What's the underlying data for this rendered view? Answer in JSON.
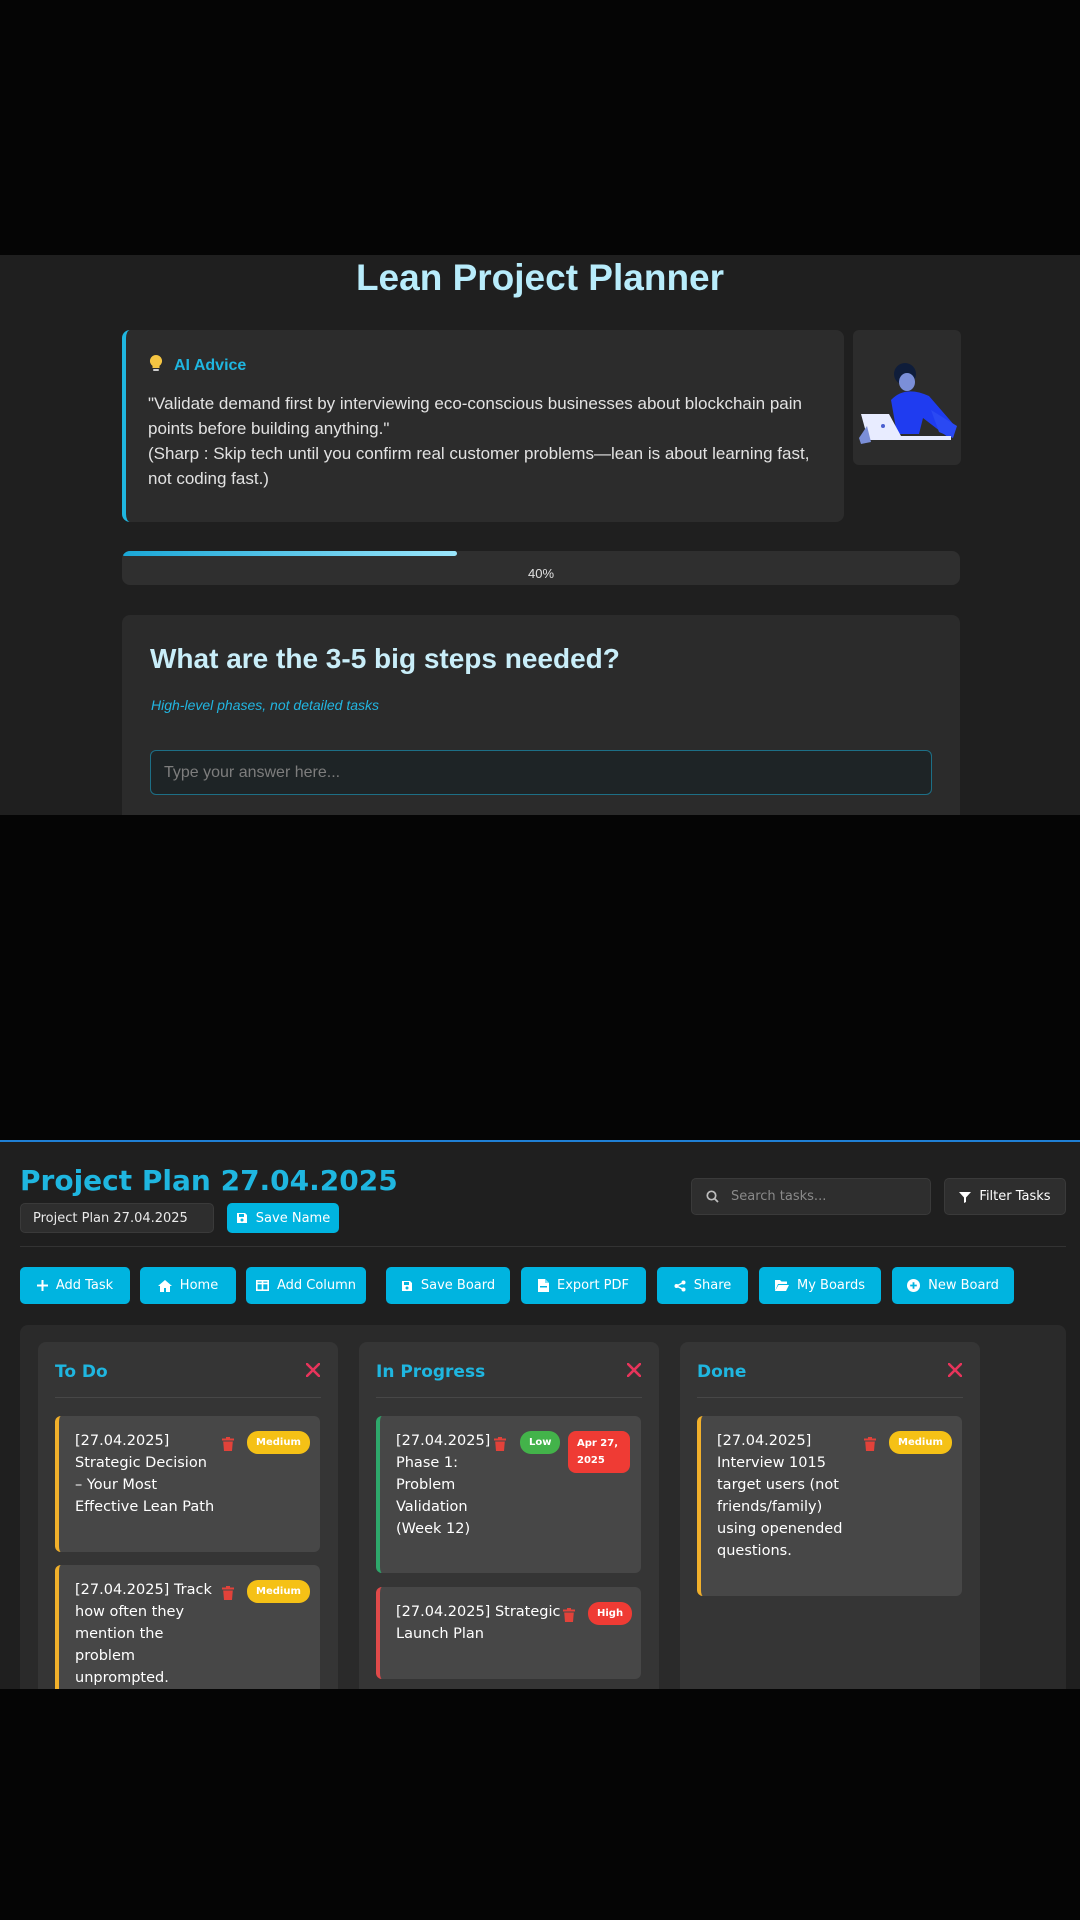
{
  "planner": {
    "title": "Lean Project Planner",
    "advice": {
      "label": "AI Advice",
      "quote": "\"Validate demand first by interviewing eco-conscious businesses about blockchain pain points before building anything.\"",
      "note": "(Sharp : Skip tech until you confirm real customer problems—lean is about learning fast, not coding fast.)"
    },
    "progress": {
      "value": 0.4,
      "label": "40%"
    },
    "question": {
      "title": "What are the 3-5 big steps needed?",
      "hint": "High-level phases, not detailed tasks",
      "placeholder": "Type your answer here...",
      "value": ""
    }
  },
  "board": {
    "title": "Project Plan 27.04.2025",
    "name_value": "Project Plan 27.04.2025",
    "save_name_label": "Save Name",
    "search_placeholder": "Search tasks...",
    "filter_label": "Filter Tasks",
    "toolbar": {
      "add_task": "Add Task",
      "home": "Home",
      "add_column": "Add Column",
      "save_board": "Save Board",
      "export_pdf": "Export PDF",
      "share": "Share",
      "my_boards": "My Boards",
      "new_board": "New Board"
    },
    "columns": [
      {
        "title": "To Do",
        "cards": [
          {
            "text": "[27.04.2025] Strategic Decision – Your Most Effective Lean Path",
            "priority": "Medium"
          },
          {
            "text": "[27.04.2025] Track how often they mention the problem unprompted.",
            "priority": "Medium"
          }
        ]
      },
      {
        "title": "In Progress",
        "cards": [
          {
            "text": "[27.04.2025] Phase 1: Problem Validation (Week 12)",
            "priority": "Low",
            "due": "Apr 27, 2025"
          },
          {
            "text": "[27.04.2025] Strategic Launch Plan",
            "priority": "High"
          }
        ]
      },
      {
        "title": "Done",
        "cards": [
          {
            "text": "[27.04.2025] Interview 1015 target users (not friends/family) using openended questions.",
            "priority": "Medium"
          }
        ]
      }
    ]
  },
  "colors": {
    "accent": "#00b4e0",
    "title_light": "#b8ecfb",
    "medium": "#f5c116",
    "low": "#43b34a",
    "high": "#ef3b34",
    "close": "#e8345b"
  },
  "icons": [
    "lightbulb-icon",
    "save-icon",
    "search-icon",
    "filter-icon",
    "plus-icon",
    "home-icon",
    "columns-icon",
    "pdf-icon",
    "share-icon",
    "folder-open-icon",
    "plus-circle-icon",
    "close-icon",
    "trash-icon"
  ]
}
